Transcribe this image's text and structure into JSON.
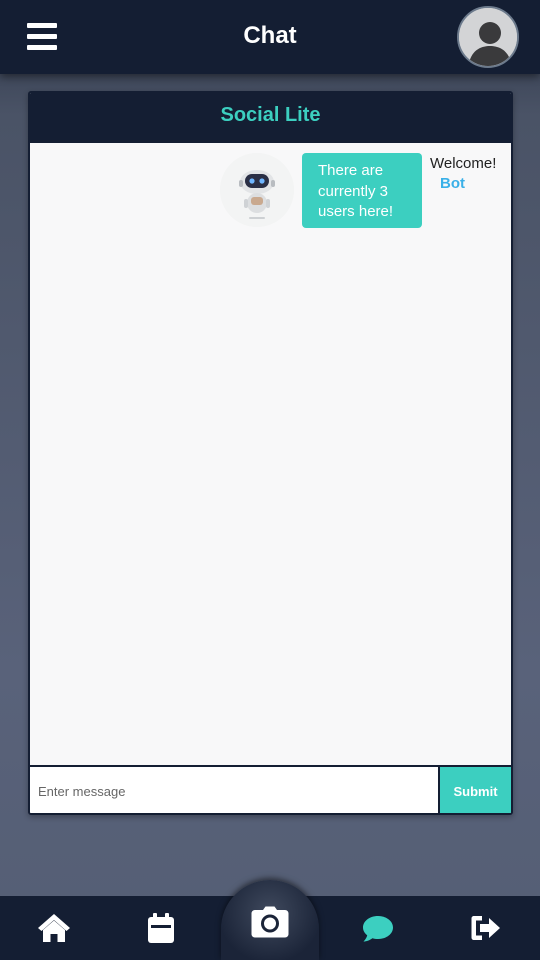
{
  "header": {
    "title": "Chat",
    "menu_icon": "hamburger-menu-icon",
    "avatar_icon": "user-avatar-icon"
  },
  "chat": {
    "room_title": "Social Lite",
    "messages": [
      {
        "sender": "Bot",
        "greeting": "Welcome!",
        "text": "There are currently 3 users here!",
        "avatar_icon": "robot-icon"
      }
    ],
    "input_placeholder": "Enter message",
    "submit_label": "Submit"
  },
  "bottom_nav": {
    "items": [
      {
        "icon": "home-icon",
        "active": false
      },
      {
        "icon": "calendar-icon",
        "active": false
      },
      {
        "icon": "camera-icon",
        "active": false
      },
      {
        "icon": "chat-bubble-icon",
        "active": true
      },
      {
        "icon": "logout-icon",
        "active": false
      }
    ]
  },
  "colors": {
    "navy": "#141e33",
    "accent": "#3ccfc0",
    "sender_blue": "#3ab0e8",
    "card_bg": "#f8f8f9"
  }
}
